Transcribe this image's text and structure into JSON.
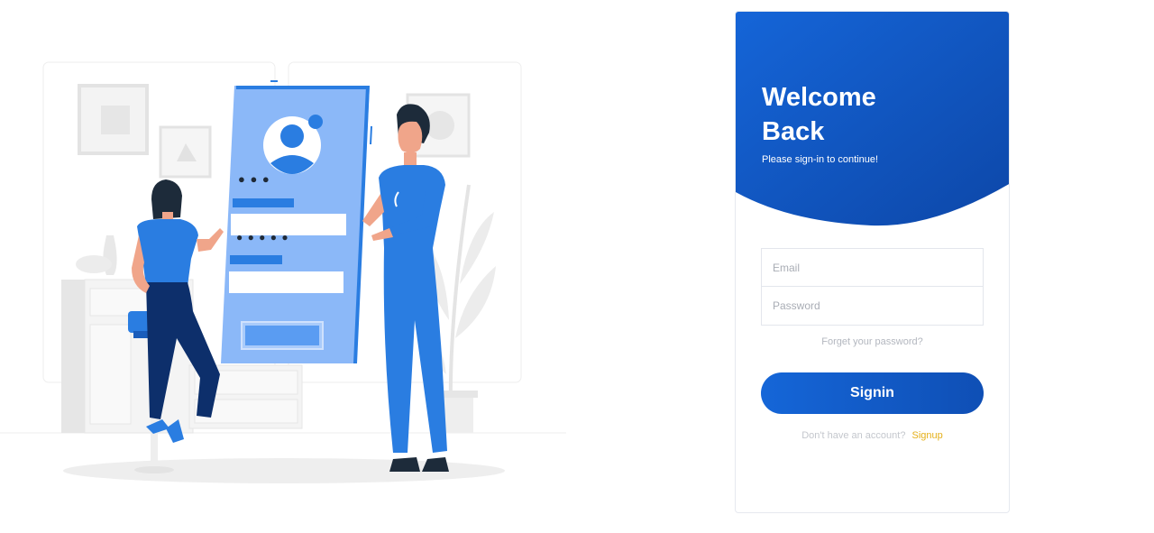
{
  "login": {
    "title": "Welcome Back",
    "subtitle": "Please sign-in to continue!",
    "email_placeholder": "Email",
    "password_placeholder": "Password",
    "forgot_link": "Forget your password?",
    "signin_label": "Signin",
    "no_account_text": "Don't have an account?",
    "signup_link": "Signup"
  },
  "illustration": {
    "pin_dots": "● ● ●",
    "password_dots": "● ● ● ● ●"
  },
  "colors": {
    "primary": "#1565d8",
    "primary_dark": "#0f4fb5",
    "accent": "#e5b019",
    "illustration_blue": "#2a7de1",
    "illustration_light": "#8bb8f8"
  }
}
